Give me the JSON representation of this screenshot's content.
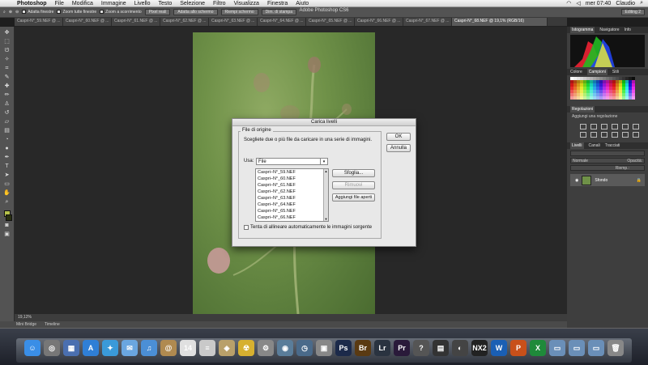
{
  "menubar": {
    "items": [
      "Photoshop",
      "File",
      "Modifica",
      "Immagine",
      "Livello",
      "Testo",
      "Selezione",
      "Filtro",
      "Visualizza",
      "Finestra",
      "Aiuto"
    ],
    "clock": "mer 07:40",
    "user": "Claudio"
  },
  "window_title": "Adobe Photoshop CS6",
  "options_bar": {
    "chk1": "Adatta finestre",
    "chk2": "Zoom tutte finestre",
    "chk3": "Zoom a scorrimento",
    "btn1": "Pixel reali",
    "btn2": "Adatta allo schermo",
    "btn3": "Riempi schermo",
    "btn4": "Dim. di stampa",
    "workspace": "Editing 2"
  },
  "tabs": [
    "Caspri-N°_59.NEF @ ...",
    "Caspri-N°_60.NEF @ ...",
    "Caspri-N°_61.NEF @ ...",
    "Caspri-N°_62.NEF @ ...",
    "Caspri-N°_63.NEF @ ...",
    "Caspri-N°_64.NEF @ ...",
    "Caspri-N°_65.NEF @ ...",
    "Caspri-N°_66.NEF @ ...",
    "Caspri-N°_67.NEF @ ...",
    "Caspri-N°_68.NEF @ 19,1% (RGB/16)"
  ],
  "status": {
    "zoom": "19,12%"
  },
  "bottom_tabs": [
    "Mini Bridge",
    "Timeline"
  ],
  "panels": {
    "histogram_tabs": [
      "Istogramma",
      "Navigatore",
      "Info"
    ],
    "color_tabs": [
      "Colore",
      "Campioni",
      "Stili"
    ],
    "adjust_tab": "Regolazioni",
    "adjust_hint": "Aggiungi una regolazione",
    "layer_tabs": [
      "Livelli",
      "Canali",
      "Tracciati"
    ],
    "blend": "Normale",
    "opacity": "Opacità:",
    "fill": "Riemp.:",
    "layer_name": "Sfondo"
  },
  "dialog": {
    "title": "Carica livelli",
    "legend": "File di origine",
    "instructions": "Scegliete due o più file da caricare in una serie di immagini.",
    "use_label": "Usa:",
    "use_value": "File",
    "files": [
      "Caspri–N°_59.NEF",
      "Caspri–N°_60.NEF",
      "Caspri–N°_61.NEF",
      "Caspri–N°_62.NEF",
      "Caspri–N°_63.NEF",
      "Caspri–N°_64.NEF",
      "Caspri–N°_65.NEF",
      "Caspri–N°_66.NEF"
    ],
    "ok": "OK",
    "cancel": "Annulla",
    "browse": "Sfoglia...",
    "remove": "Rimuovi",
    "add_open": "Aggiungi file aperti",
    "align_label": "Tenta di allineare automaticamente le immagini sorgente"
  },
  "dock_icons": [
    {
      "name": "finder-icon",
      "glyph": "☺",
      "color": "#3a8ee6"
    },
    {
      "name": "launchpad-icon",
      "glyph": "◎",
      "color": "#777"
    },
    {
      "name": "mission-control-icon",
      "glyph": "▦",
      "color": "#4a6fb0"
    },
    {
      "name": "app-store-icon",
      "glyph": "A",
      "color": "#2f7fd6"
    },
    {
      "name": "safari-icon",
      "glyph": "✦",
      "color": "#3a9ad9"
    },
    {
      "name": "mail-icon",
      "glyph": "✉",
      "color": "#6aa6e0"
    },
    {
      "name": "itunes-icon",
      "glyph": "♫",
      "color": "#4b8fd6"
    },
    {
      "name": "contacts-icon",
      "glyph": "@",
      "color": "#b08a50"
    },
    {
      "name": "calendar-icon",
      "glyph": "14",
      "color": "#e0e0e0"
    },
    {
      "name": "notes-icon",
      "glyph": "≡",
      "color": "#c9c9c9"
    },
    {
      "name": "preview-icon",
      "glyph": "◈",
      "color": "#b9a06a"
    },
    {
      "name": "disk-utility-icon",
      "glyph": "☢",
      "color": "#d6b030"
    },
    {
      "name": "system-preferences-icon",
      "glyph": "⚙",
      "color": "#888"
    },
    {
      "name": "trash-utility-icon",
      "glyph": "◉",
      "color": "#5a7d9a"
    },
    {
      "name": "time-machine-icon",
      "glyph": "◷",
      "color": "#4a6a8a"
    },
    {
      "name": "photobooth-icon",
      "glyph": "▣",
      "color": "#888"
    },
    {
      "name": "photoshop-icon",
      "glyph": "Ps",
      "color": "#1c2a4a"
    },
    {
      "name": "bridge-icon",
      "glyph": "Br",
      "color": "#5a3a12"
    },
    {
      "name": "lightroom-icon",
      "glyph": "Lr",
      "color": "#2a3340"
    },
    {
      "name": "premiere-icon",
      "glyph": "Pr",
      "color": "#2a1a3a"
    },
    {
      "name": "help-icon",
      "glyph": "?",
      "color": "#555"
    },
    {
      "name": "camera-icon",
      "glyph": "▤",
      "color": "#333"
    },
    {
      "name": "capture-icon",
      "glyph": "◐",
      "color": "#444"
    },
    {
      "name": "nx2-icon",
      "glyph": "NX2",
      "color": "#222"
    },
    {
      "name": "word-icon",
      "glyph": "W",
      "color": "#1a5fb4"
    },
    {
      "name": "powerpoint-icon",
      "glyph": "P",
      "color": "#c8501a"
    },
    {
      "name": "excel-icon",
      "glyph": "X",
      "color": "#1f8a3a"
    },
    {
      "name": "folder-apps-icon",
      "glyph": "▭",
      "color": "#6a8fb8"
    },
    {
      "name": "folder-docs-icon",
      "glyph": "▭",
      "color": "#6a8fb8"
    },
    {
      "name": "folder-downloads-icon",
      "glyph": "▭",
      "color": "#6a8fb8"
    },
    {
      "name": "trash-icon",
      "glyph": "🗑",
      "color": "#888"
    }
  ]
}
